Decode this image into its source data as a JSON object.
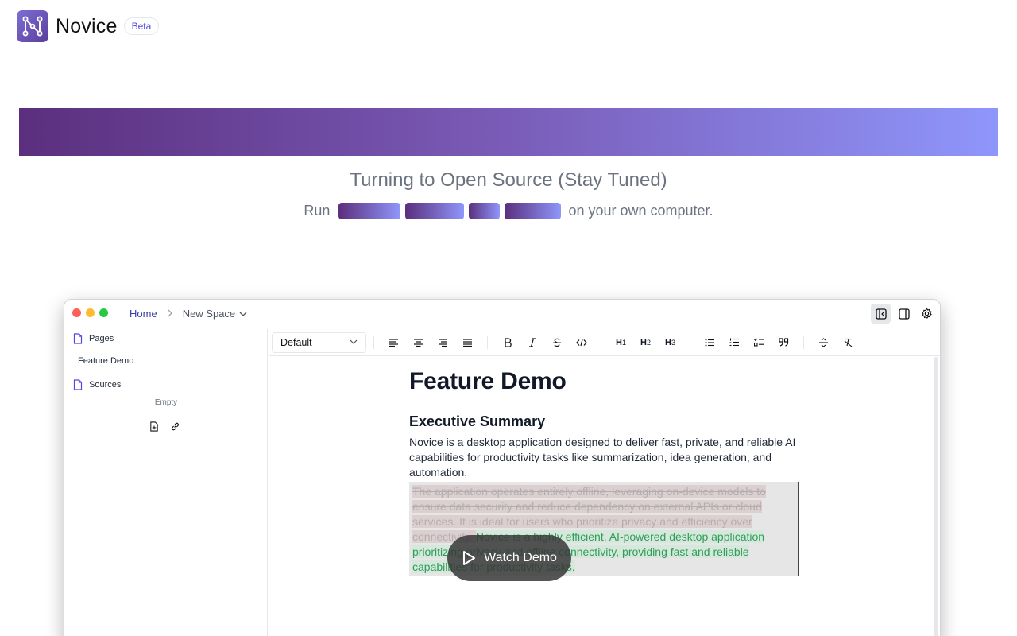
{
  "header": {
    "brand": "Novice",
    "badge": "Beta"
  },
  "hero": {
    "title": "Turning to Open Source (Stay Tuned)",
    "sub_prefix": "Run",
    "sub_suffix": "on your own computer."
  },
  "window": {
    "breadcrumb": {
      "home": "Home",
      "space": "New Space"
    },
    "sidebar": {
      "pages_label": "Pages",
      "page_item": "Feature Demo",
      "sources_label": "Sources",
      "empty_text": "Empty"
    },
    "toolbar": {
      "style_select": "Default"
    },
    "document": {
      "title": "Feature Demo",
      "section": "Executive Summary",
      "paragraph": "Novice is a desktop application designed to deliver fast, private, and reliable AI capabilities for productivity tasks like summarization, idea generation, and automation.",
      "deleted_text": " The application operates entirely offline, leveraging on-device models to ensure data security and reduce dependency on external APIs or cloud services. It is ideal for users who prioritize privacy and efficiency over connectivity. ",
      "inserted_text": "Novice is a highly efficient, AI-powered desktop application prioritizing privacy and offline connectivity, providing fast and reliable capabilities for productivity tasks."
    },
    "watch_demo": "Watch Demo"
  },
  "colors": {
    "accent": "#4f46e5",
    "banner_start": "#5b2f7e",
    "banner_end": "#8f96fb",
    "inserted": "#2f9e58"
  }
}
